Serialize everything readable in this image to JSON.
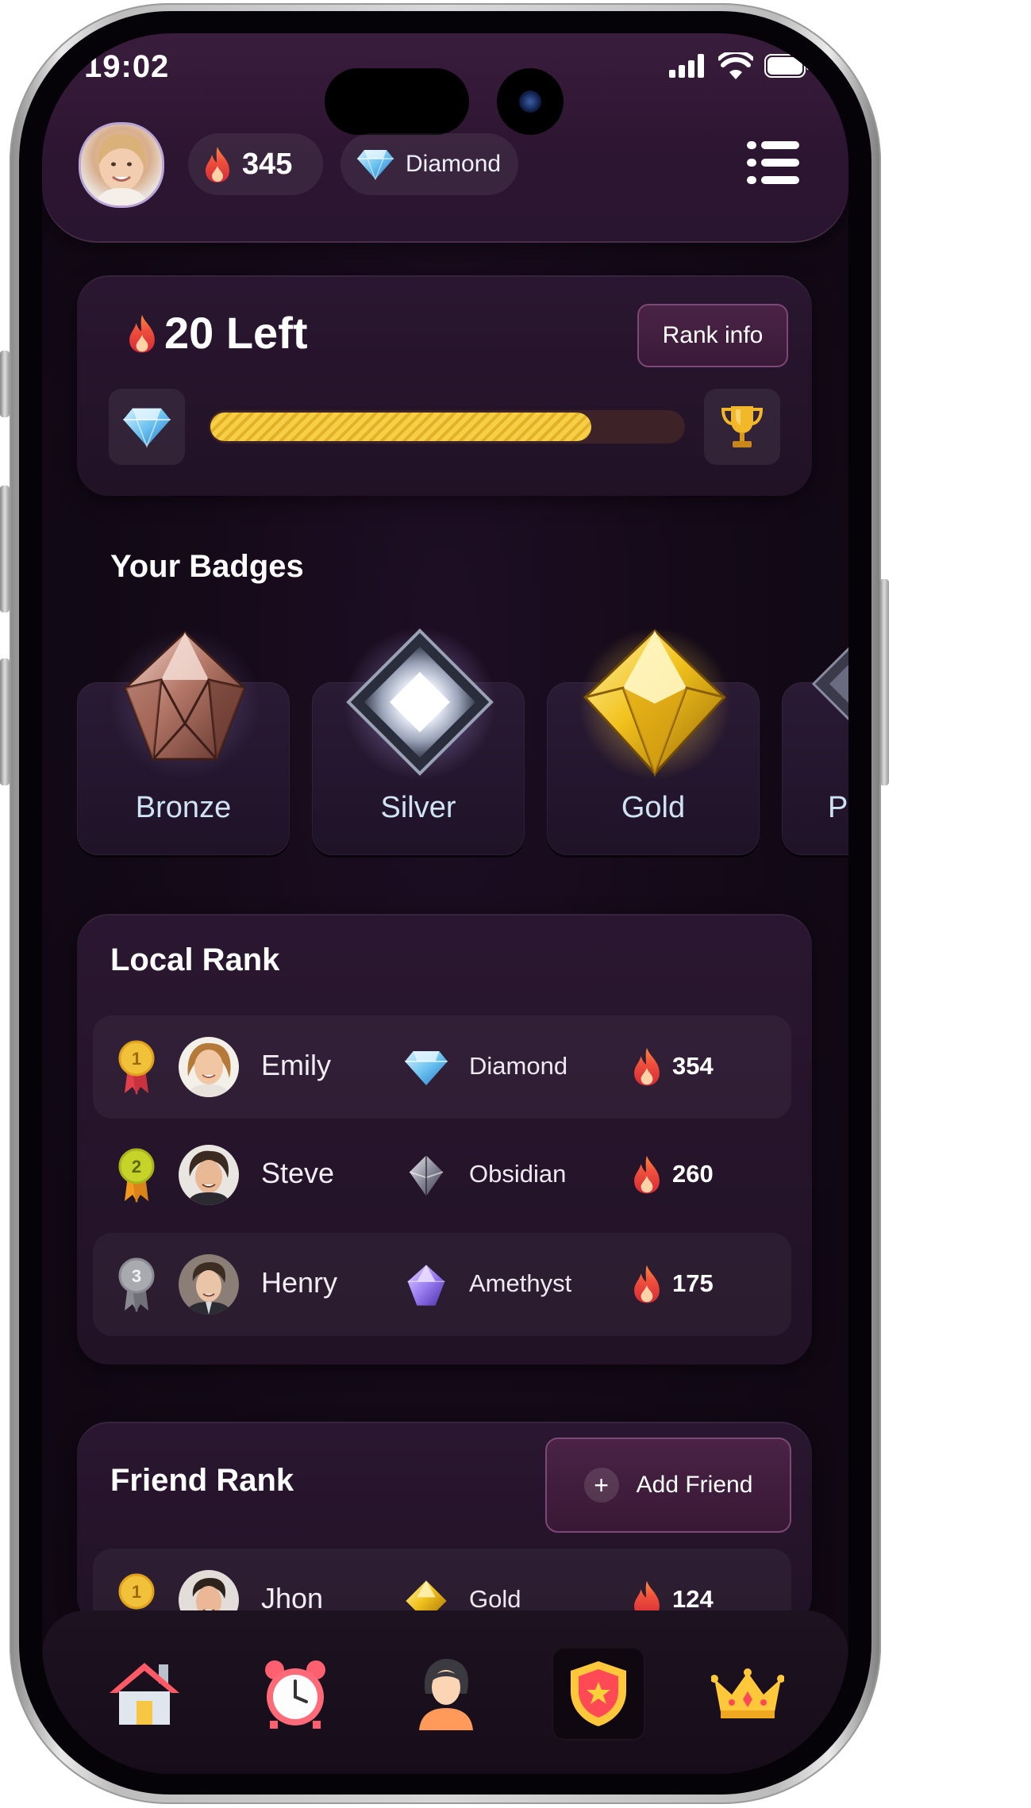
{
  "status": {
    "time": "19:02"
  },
  "header": {
    "streak_count": "345",
    "tier_label": "Diamond"
  },
  "progress": {
    "left_label": "20 Left",
    "rank_info_label": "Rank info",
    "fraction": 0.8
  },
  "badges": {
    "title": "Your Badges",
    "items": [
      {
        "name": "Bronze",
        "color": "#b87a6a"
      },
      {
        "name": "Silver",
        "color": "#c9d3e3"
      },
      {
        "name": "Gold",
        "color": "#e9b21f"
      },
      {
        "name": "P",
        "color": "#8a8aa0"
      }
    ]
  },
  "local_rank": {
    "title": "Local Rank",
    "rows": [
      {
        "position": "1",
        "name": "Emily",
        "tier": "Diamond",
        "score": "354",
        "gem": "diamond-gem-icon"
      },
      {
        "position": "2",
        "name": "Steve",
        "tier": "Obsidian",
        "score": "260",
        "gem": "obsidian-gem-icon"
      },
      {
        "position": "3",
        "name": "Henry",
        "tier": "Amethyst",
        "score": "175",
        "gem": "amethyst-gem-icon"
      }
    ]
  },
  "friend_rank": {
    "title": "Friend Rank",
    "add_label": "Add Friend",
    "rows": [
      {
        "position": "1",
        "name": "Jhon",
        "tier": "Gold",
        "score": "124",
        "gem": "gold-gem-icon"
      }
    ]
  },
  "tabs": [
    {
      "name": "home",
      "icon": "house-icon",
      "active": false
    },
    {
      "name": "alarm",
      "icon": "alarm-clock-icon",
      "active": false
    },
    {
      "name": "profile",
      "icon": "person-icon",
      "active": false
    },
    {
      "name": "rank",
      "icon": "shield-star-icon",
      "active": true
    },
    {
      "name": "leaderboard",
      "icon": "crown-icon",
      "active": false
    }
  ],
  "colors": {
    "accent": "#7c4877",
    "progress": "#f7cf46",
    "flame": "#e8423c",
    "background": "#140a18"
  }
}
